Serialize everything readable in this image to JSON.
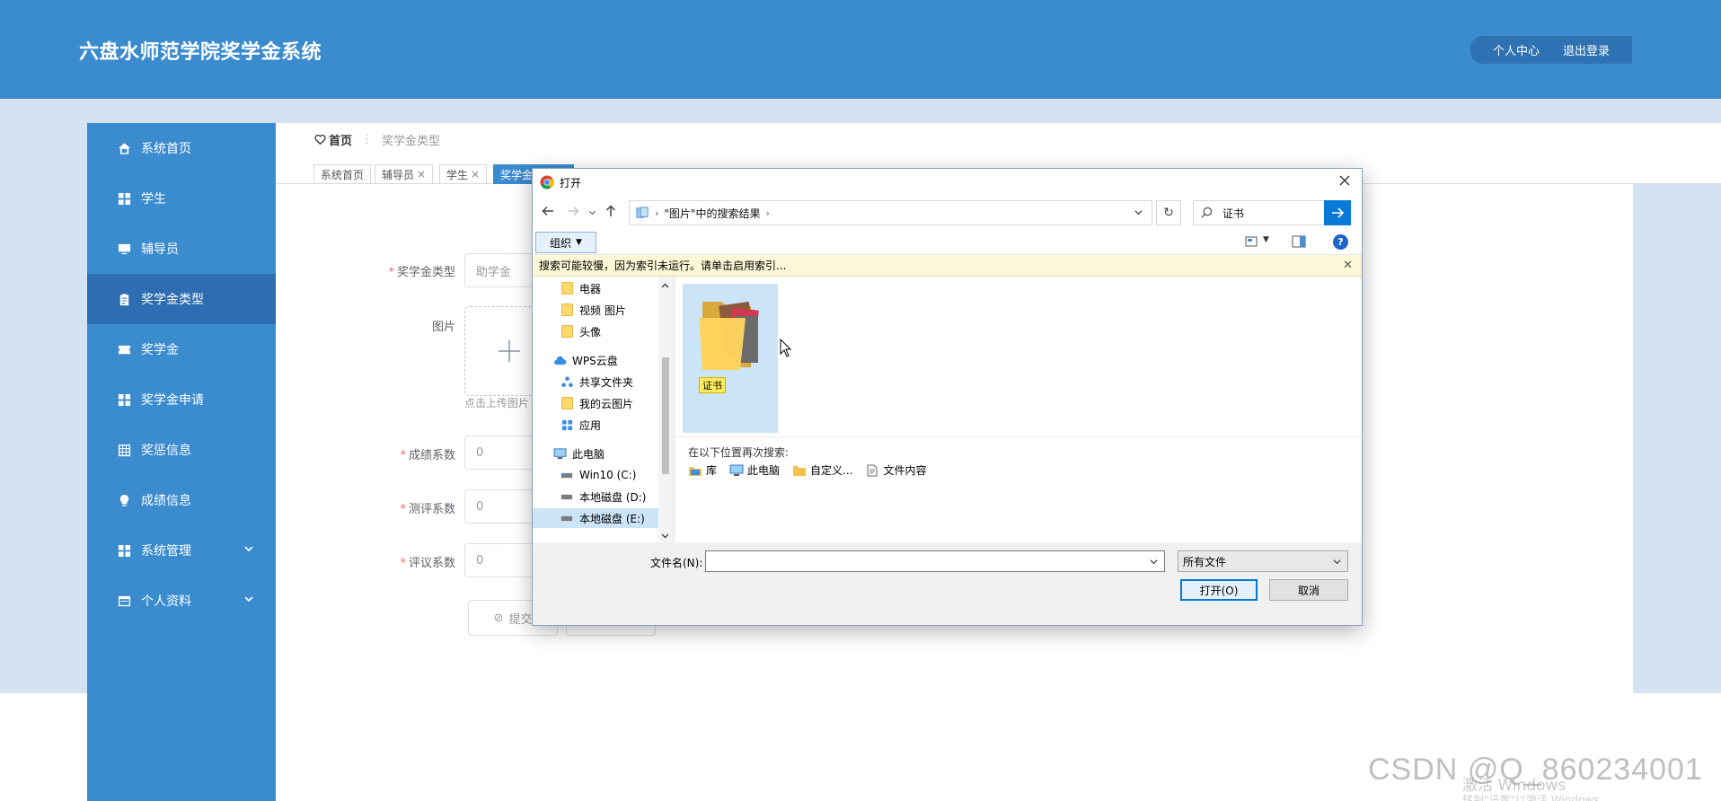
{
  "header": {
    "title": "六盘水师范学院奖学金系统",
    "nav": [
      "个人中心",
      "退出登录"
    ]
  },
  "sidebar": {
    "items": [
      {
        "label": "系统首页",
        "icon": "home-icon"
      },
      {
        "label": "学生",
        "icon": "grid-icon"
      },
      {
        "label": "辅导员",
        "icon": "monitor-icon"
      },
      {
        "label": "奖学金类型",
        "icon": "clipboard-icon",
        "active": true
      },
      {
        "label": "奖学金",
        "icon": "ticket-icon"
      },
      {
        "label": "奖学金申请",
        "icon": "grid-icon"
      },
      {
        "label": "奖惩信息",
        "icon": "table-icon"
      },
      {
        "label": "成绩信息",
        "icon": "bulb-icon"
      },
      {
        "label": "系统管理",
        "icon": "grid-icon",
        "expandable": true
      },
      {
        "label": "个人资料",
        "icon": "card-icon",
        "expandable": true
      }
    ]
  },
  "breadcrumb": {
    "home": "首页",
    "current": "奖学金类型"
  },
  "tabs": [
    {
      "label": "系统首页",
      "closable": false
    },
    {
      "label": "辅导员",
      "closable": true
    },
    {
      "label": "学生",
      "closable": true
    },
    {
      "label": "奖学金",
      "closable": false,
      "active": true
    }
  ],
  "form": {
    "type_label": "奖学金类型",
    "type_placeholder": "助学金",
    "image_label": "图片",
    "upload_hint": "点击上传图片",
    "score_label": "成绩系数",
    "score_value": "0",
    "eval_label": "测评系数",
    "eval_value": "0",
    "review_label": "评议系数",
    "review_value": "0",
    "submit_label": "提交"
  },
  "dialog": {
    "title": "打开",
    "address": "\"图片\"中的搜索结果",
    "search_value": "证书",
    "organize_label": "组织",
    "infobar": "搜索可能较慢，因为索引未运行。请单击启用索引...",
    "tree": [
      {
        "label": "电器",
        "icon": "folder-icon",
        "indent": 1
      },
      {
        "label": "视频 图片",
        "icon": "folder-icon",
        "indent": 1
      },
      {
        "label": "头像",
        "icon": "folder-icon",
        "indent": 1
      },
      {
        "label": "WPS云盘",
        "icon": "cloud-icon",
        "indent": 0
      },
      {
        "label": "共享文件夹",
        "icon": "share-icon",
        "indent": 1
      },
      {
        "label": "我的云图片",
        "icon": "folder-icon",
        "indent": 1
      },
      {
        "label": "应用",
        "icon": "apps-icon",
        "indent": 1
      },
      {
        "label": "此电脑",
        "icon": "pc-icon",
        "indent": 0
      },
      {
        "label": "Win10 (C:)",
        "icon": "drive-icon",
        "indent": 1
      },
      {
        "label": "本地磁盘 (D:)",
        "icon": "drive-icon",
        "indent": 1
      },
      {
        "label": "本地磁盘 (E:)",
        "icon": "drive-icon",
        "indent": 1,
        "selected": true
      }
    ],
    "file": {
      "label": "证书"
    },
    "research_title": "在以下位置再次搜索:",
    "research_items": [
      {
        "label": "库",
        "icon": "library-icon"
      },
      {
        "label": "此电脑",
        "icon": "pc-icon"
      },
      {
        "label": "自定义...",
        "icon": "folder-icon"
      },
      {
        "label": "文件内容",
        "icon": "document-icon"
      }
    ],
    "filename_label": "文件名(N):",
    "filename_value": "",
    "filetype_value": "所有文件",
    "open_label": "打开(O)",
    "cancel_label": "取消"
  },
  "watermarks": {
    "csdn": "CSDN @Q_860234001",
    "windows_activate": "激活 Windows",
    "windows_hint": "转到\"设置\"以激活 Windows。"
  }
}
